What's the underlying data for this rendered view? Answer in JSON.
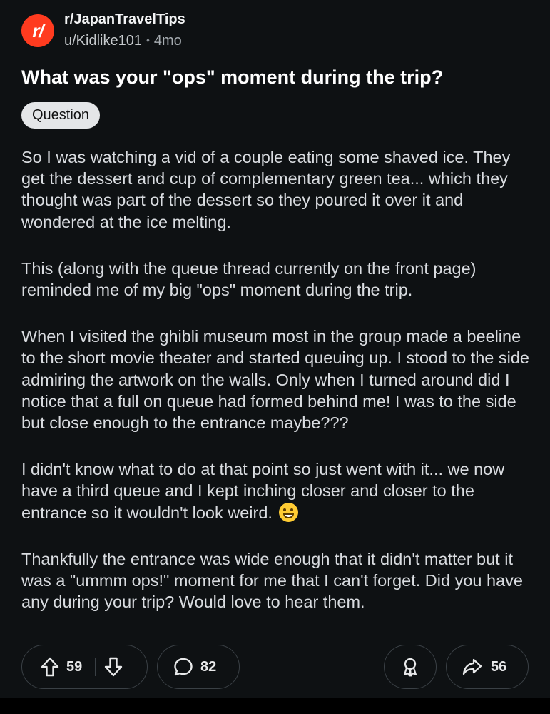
{
  "post": {
    "subreddit": "r/JapanTravelTips",
    "subreddit_icon_text": "r/",
    "author": "u/Kidlike101",
    "age": "4mo",
    "title": "What was your \"ops\" moment during the trip?",
    "flair": "Question",
    "paragraphs": [
      "So I was watching a vid of a couple eating some shaved ice. They get the dessert and cup of complementary green tea... which they thought was part of the dessert so they poured it over it and wondered at the ice melting.",
      "This (along with the queue thread currently on the front page) reminded me of my big \"ops\" moment during the trip.",
      "When I visited the ghibli museum most in the group made a beeline to the short movie theater and started queuing up. I stood to the side admiring the artwork on the walls. Only when I turned around did I notice that a full on queue had formed behind me! I was to the side but close enough to the entrance maybe???",
      "I didn't know what to do at that point so just went with it... we now have a third queue and I kept inching closer and closer to the entrance so it wouldn't look weird.",
      "Thankfully the entrance was wide enough that it didn't matter but it was a \"ummm ops!\" moment for me that I can't forget. Did you have any during your trip? Would love to hear them."
    ],
    "emoji_icon": "grinning-sweat-emoji"
  },
  "actions": {
    "upvotes": "59",
    "comments": "82",
    "shares": "56",
    "icons": {
      "upvote": "arrow-up-icon",
      "downvote": "arrow-down-icon",
      "comment": "comment-bubble-icon",
      "award": "award-icon",
      "share": "share-arrow-icon"
    }
  },
  "colors": {
    "background": "#0e1113",
    "subreddit_icon": "#ff3b1f",
    "flair_bg": "#e4e6e8"
  }
}
